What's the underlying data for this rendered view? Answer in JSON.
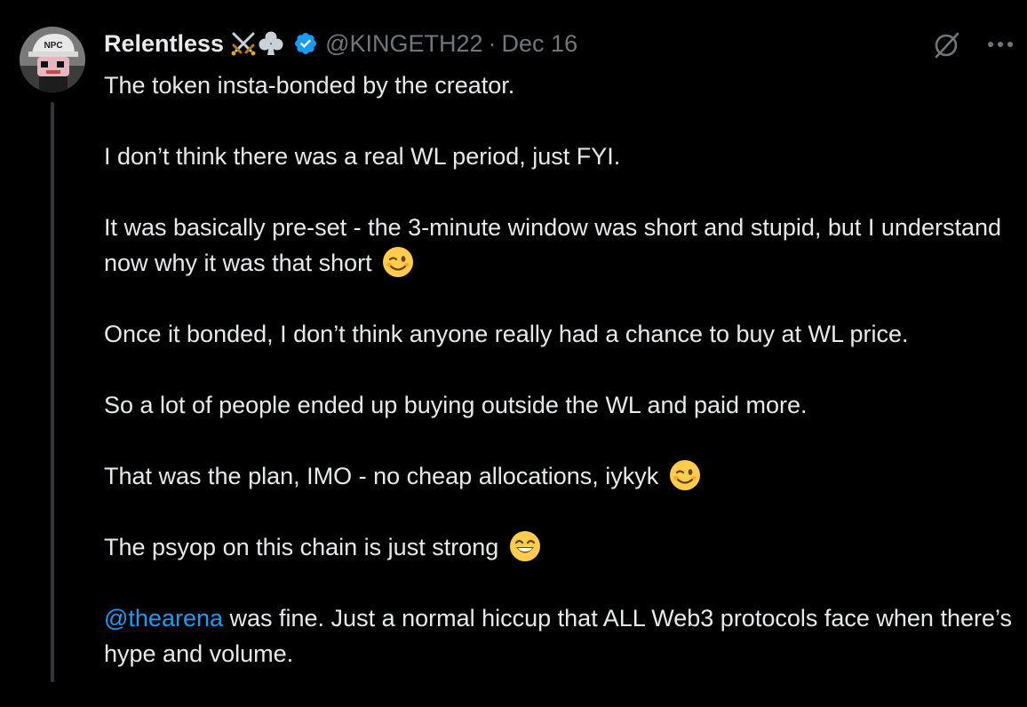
{
  "author": {
    "name": "Relentless",
    "name_emoji": [
      "crossed-swords-emoji",
      "club-suit-emoji"
    ],
    "verified": true,
    "handle": "@KINGETH22",
    "separator": "·",
    "date": "Dec 16",
    "avatar_badge": "NPC"
  },
  "actions": {
    "grok_icon": "grok-icon",
    "more_icon": "more-icon"
  },
  "tweet": {
    "p1": "The token insta-bonded by the creator.",
    "p2": "I don’t think there was a real WL period, just FYI.",
    "p3": "It was basically pre-set - the 3-minute window was short and stupid, but I understand now why it was that short",
    "p4": "Once it bonded, I don’t think anyone really had a chance to buy at WL price.",
    "p5": "So a lot of people ended up buying outside the WL and paid more.",
    "p6": "That was the plan, IMO - no cheap allocations, iykyk",
    "p7": "The psyop on this chain is just strong",
    "p8_mention": "@thearena",
    "p8_rest": " was fine. Just a normal hiccup that ALL Web3 protocols face when there’s hype and volume."
  },
  "colors": {
    "background": "#000000",
    "text": "#e7e9ea",
    "muted": "#71767b",
    "link": "#1d9bf0",
    "verified": "#1d9bf0"
  }
}
